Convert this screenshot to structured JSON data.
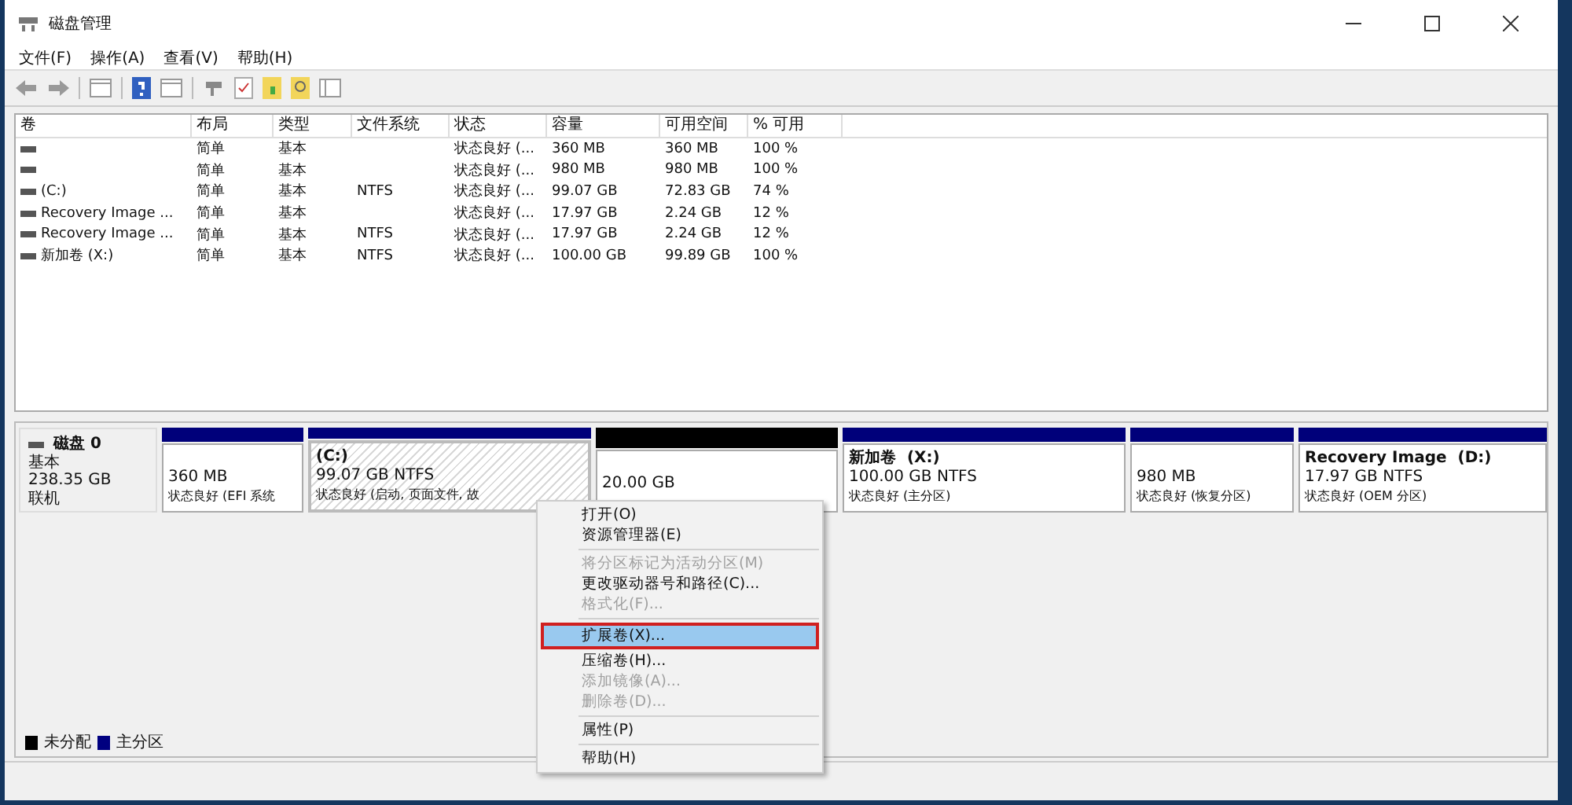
{
  "window": {
    "title": "磁盘管理"
  },
  "menu": [
    "文件(F)",
    "操作(A)",
    "查看(V)",
    "帮助(H)"
  ],
  "table": {
    "columns": [
      "卷",
      "布局",
      "类型",
      "文件系统",
      "状态",
      "容量",
      "可用空间",
      "% 可用"
    ],
    "rows": [
      [
        "",
        "简单",
        "基本",
        "",
        "状态良好 (...",
        "360 MB",
        "360 MB",
        "100 %"
      ],
      [
        "",
        "简单",
        "基本",
        "",
        "状态良好 (...",
        "980 MB",
        "980 MB",
        "100 %"
      ],
      [
        "(C:)",
        "简单",
        "基本",
        "NTFS",
        "状态良好 (...",
        "99.07 GB",
        "72.83 GB",
        "74 %"
      ],
      [
        "Recovery Image ...",
        "简单",
        "基本",
        "",
        "状态良好 (...",
        "17.97 GB",
        "2.24 GB",
        "12 %"
      ],
      [
        "Recovery Image ...",
        "简单",
        "基本",
        "NTFS",
        "状态良好 (...",
        "17.97 GB",
        "2.24 GB",
        "12 %"
      ],
      [
        "新加卷 (X:)",
        "简单",
        "基本",
        "NTFS",
        "状态良好 (...",
        "100.00 GB",
        "99.89 GB",
        "100 %"
      ]
    ]
  },
  "disk": {
    "name": "磁盘 0",
    "type": "基本",
    "size": "238.35 GB",
    "status": "联机",
    "partitions": [
      {
        "kind": "primary",
        "selected": false,
        "size": "360 MB",
        "status": "状态良好 (EFI 系统"
      },
      {
        "kind": "primary",
        "selected": true,
        "name": "(C:)",
        "size": "99.07 GB NTFS",
        "status": "状态良好 (启动, 页面文件, 故"
      },
      {
        "kind": "unallocated",
        "selected": false,
        "size": "20.00 GB"
      },
      {
        "kind": "primary",
        "selected": false,
        "name": "新加卷  (X:)",
        "size": "100.00 GB NTFS",
        "status": "状态良好 (主分区)"
      },
      {
        "kind": "primary",
        "selected": false,
        "size": "980 MB",
        "status": "状态良好 (恢复分区)"
      },
      {
        "kind": "primary",
        "selected": false,
        "name": "Recovery Image  (D:)",
        "size": "17.97 GB NTFS",
        "status": "状态良好 (OEM 分区)"
      }
    ]
  },
  "legend": [
    {
      "label": "未分配",
      "color": "#000000"
    },
    {
      "label": "主分区",
      "color": "#000080"
    }
  ],
  "context_menu": [
    {
      "kind": "item",
      "label": "打开(O)",
      "disabled": false,
      "selected": false
    },
    {
      "kind": "item",
      "label": "资源管理器(E)",
      "disabled": false,
      "selected": false
    },
    {
      "kind": "separator"
    },
    {
      "kind": "item",
      "label": "将分区标记为活动分区(M)",
      "disabled": true,
      "selected": false
    },
    {
      "kind": "item",
      "label": "更改驱动器号和路径(C)...",
      "disabled": false,
      "selected": false
    },
    {
      "kind": "item",
      "label": "格式化(F)...",
      "disabled": true,
      "selected": false
    },
    {
      "kind": "separator"
    },
    {
      "kind": "item",
      "label": "扩展卷(X)...",
      "disabled": false,
      "selected": true
    },
    {
      "kind": "item",
      "label": "压缩卷(H)...",
      "disabled": false,
      "selected": false
    },
    {
      "kind": "item",
      "label": "添加镜像(A)...",
      "disabled": true,
      "selected": false
    },
    {
      "kind": "item",
      "label": "删除卷(D)...",
      "disabled": true,
      "selected": false
    },
    {
      "kind": "separator"
    },
    {
      "kind": "item",
      "label": "属性(P)",
      "disabled": false,
      "selected": false
    },
    {
      "kind": "separator"
    },
    {
      "kind": "item",
      "label": "帮助(H)",
      "disabled": false,
      "selected": false
    }
  ]
}
